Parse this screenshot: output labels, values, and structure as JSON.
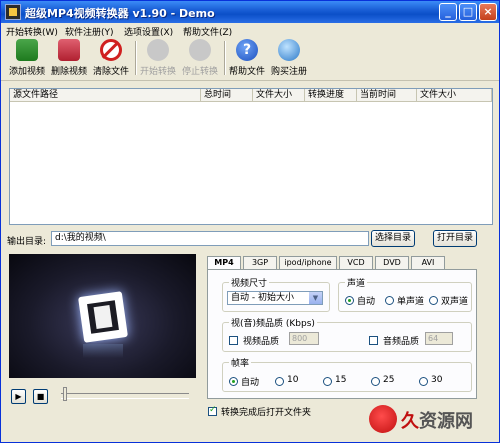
{
  "window": {
    "title": "超级MP4视频转换器 v1.90 - Demo",
    "controls": [
      "_",
      "□",
      "×"
    ]
  },
  "menu": {
    "items": [
      "开始转换(W)",
      "软件注册(Y)",
      "选项设置(X)",
      "帮助文件(Z)"
    ]
  },
  "toolbar": {
    "buttons": [
      {
        "label": "添加视频",
        "icon": "add-video-icon",
        "enabled": true
      },
      {
        "label": "删除视频",
        "icon": "delete-video-icon",
        "enabled": true
      },
      {
        "label": "清除文件",
        "icon": "clear-icon",
        "enabled": true
      },
      {
        "label": "开始转换",
        "icon": "start-convert-icon",
        "enabled": false
      },
      {
        "label": "停止转换",
        "icon": "stop-convert-icon",
        "enabled": false
      },
      {
        "label": "帮助文件",
        "icon": "help-icon",
        "enabled": true
      },
      {
        "label": "购买注册",
        "icon": "buy-register-icon",
        "enabled": true
      }
    ]
  },
  "file_list": {
    "columns": [
      "源文件路径",
      "总时间",
      "文件大小",
      "转换进度",
      "当前时间",
      "文件大小"
    ],
    "rows": []
  },
  "output": {
    "label": "输出目录:",
    "path": "d:\\我的视频\\",
    "choose_button": "选择目录",
    "open_button": "打开目录"
  },
  "player": {
    "play_glyph": "▶",
    "stop_glyph": "■"
  },
  "tabs": [
    "MP4",
    "3GP",
    "ipod/iphone",
    "VCD",
    "DVD",
    "AVI"
  ],
  "active_tab": "MP4",
  "settings": {
    "video_size": {
      "title": "视频尺寸",
      "selected": "自动 - 初始大小"
    },
    "audio_channel": {
      "title": "声道",
      "options": [
        "自动",
        "单声道",
        "双声道"
      ],
      "selected": "自动"
    },
    "quality": {
      "title": "视(音)频品质 (Kbps)",
      "video_label": "视频品质",
      "video_value": "800",
      "video_checked": false,
      "audio_label": "音频品质",
      "audio_value": "64",
      "audio_checked": false
    },
    "frame_rate": {
      "title": "帧率",
      "options": [
        "自动",
        "10",
        "15",
        "25",
        "30"
      ],
      "selected": "自动"
    }
  },
  "open_after_convert": {
    "label": "转换完成后打开文件夹",
    "checked": true
  },
  "watermark": {
    "text_red": "久",
    "text_gray": "资源网"
  }
}
